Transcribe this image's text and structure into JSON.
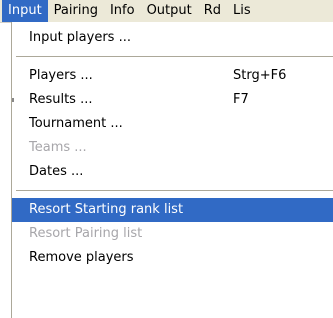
{
  "menubar": {
    "items": [
      {
        "label": "Input"
      },
      {
        "label": "Pairing"
      },
      {
        "label": "Info"
      },
      {
        "label": "Output"
      },
      {
        "label": "Rd"
      },
      {
        "label": "Lis"
      }
    ]
  },
  "menu": {
    "input_players": "Input players ...",
    "players": {
      "label": "Players ...",
      "shortcut": "Strg+F6"
    },
    "results": {
      "label": "Results ...",
      "shortcut": "F7"
    },
    "tournament": "Tournament ...",
    "teams": "Teams ...",
    "dates": "Dates ...",
    "resort_starting": "Resort Starting rank list",
    "resort_pairing": "Resort Pairing list",
    "remove_players": "Remove players"
  },
  "colors": {
    "highlight": "#316ac5",
    "menubar_bg": "#ece9d8",
    "disabled_text": "#a7a6aa"
  }
}
